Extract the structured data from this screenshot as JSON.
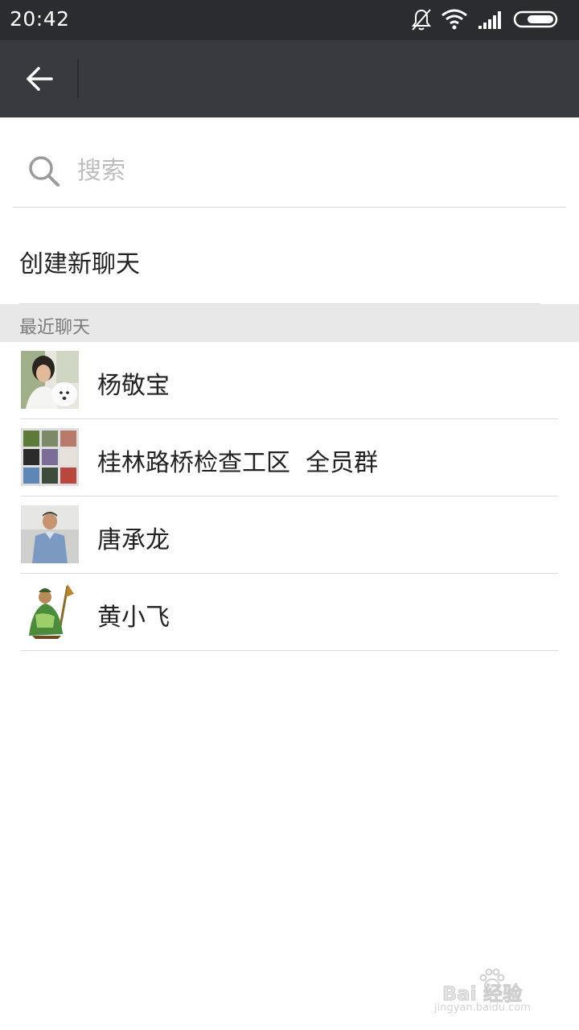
{
  "status_bar": {
    "time": "20:42",
    "icons": [
      "mute-bell-icon",
      "wifi-icon",
      "signal-icon",
      "battery-icon"
    ]
  },
  "title_bar": {
    "back_icon": "back-arrow-icon"
  },
  "search": {
    "placeholder": "搜索",
    "value": ""
  },
  "create_chat": {
    "label": "创建新聊天"
  },
  "recent": {
    "header": "最近聊天",
    "items": [
      {
        "name": "杨敬宝",
        "avatar": "person-with-white-dog"
      },
      {
        "name": "桂林路桥检查工区  全员群",
        "avatar": "group-mosaic"
      },
      {
        "name": "唐承龙",
        "avatar": "person-in-uniform"
      },
      {
        "name": "黄小飞",
        "avatar": "warrior-figure"
      }
    ]
  },
  "watermark": {
    "logo": "Bai 经验",
    "url": "jingyan.baidu.com"
  },
  "colors": {
    "status_bar_bg": "#2b2c30",
    "title_bar_bg": "#393a3f",
    "section_header_bg": "#e8e8e8",
    "divider": "#d9d9d9"
  }
}
